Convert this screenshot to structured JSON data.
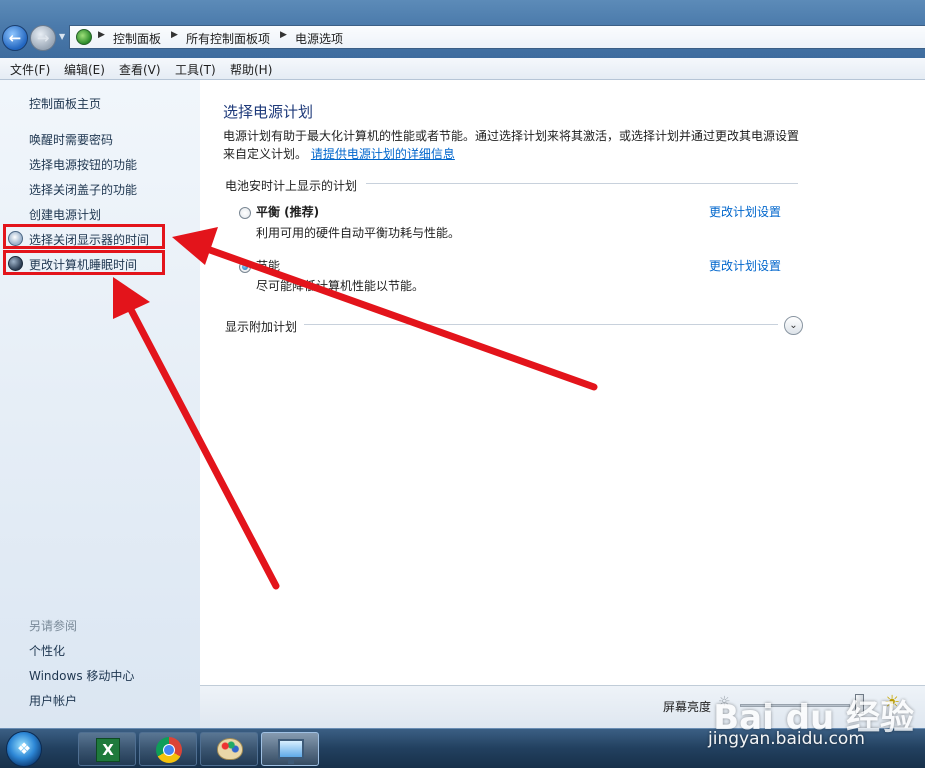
{
  "breadcrumb": [
    "控制面板",
    "所有控制面板项",
    "电源选项"
  ],
  "menu": [
    "文件(F)",
    "编辑(E)",
    "查看(V)",
    "工具(T)",
    "帮助(H)"
  ],
  "sidebar": {
    "home": "控制面板主页",
    "links": [
      "唤醒时需要密码",
      "选择电源按钮的功能",
      "选择关闭盖子的功能",
      "创建电源计划",
      "选择关闭显示器的时间",
      "更改计算机睡眠时间"
    ],
    "see_also_label": "另请参阅",
    "see_also": [
      "个性化",
      "Windows 移动中心",
      "用户帐户"
    ]
  },
  "main": {
    "title": "选择电源计划",
    "desc": "电源计划有助于最大化计算机的性能或者节能。通过选择计划来将其激活，或选择计划并通过更改其电源设置来自定义计划。",
    "details_link": "请提供电源计划的详细信息",
    "battery_section": "电池安时计上显示的计划",
    "plans": [
      {
        "name": "平衡 (推荐)",
        "desc": "利用可用的硬件自动平衡功耗与性能。",
        "link": "更改计划设置",
        "selected": false
      },
      {
        "name": "节能",
        "desc": "尽可能降低计算机性能以节能。",
        "link": "更改计划设置",
        "selected": true
      }
    ],
    "more_plans": "显示附加计划"
  },
  "bottom": {
    "brightness_label": "屏幕亮度"
  },
  "watermark": {
    "main": "Bai du 经验",
    "sub": "jingyan.baidu.com"
  },
  "colors": {
    "highlight_red": "#e3141b",
    "link_blue": "#0066cc",
    "title_blue": "#1e3a7a"
  }
}
